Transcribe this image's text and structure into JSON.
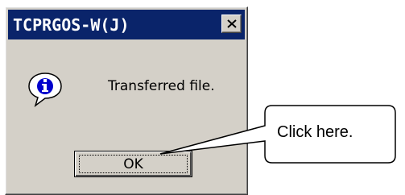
{
  "dialog": {
    "title": "TCPRGOS-W(J)",
    "message": "Transferred file.",
    "ok_label": "OK",
    "icon": "info-icon",
    "close_icon": "close-icon"
  },
  "callout": {
    "text": "Click here."
  },
  "colors": {
    "titlebar": "#0a246a",
    "face": "#d4d0c8",
    "icon_blue": "#0000cc"
  }
}
